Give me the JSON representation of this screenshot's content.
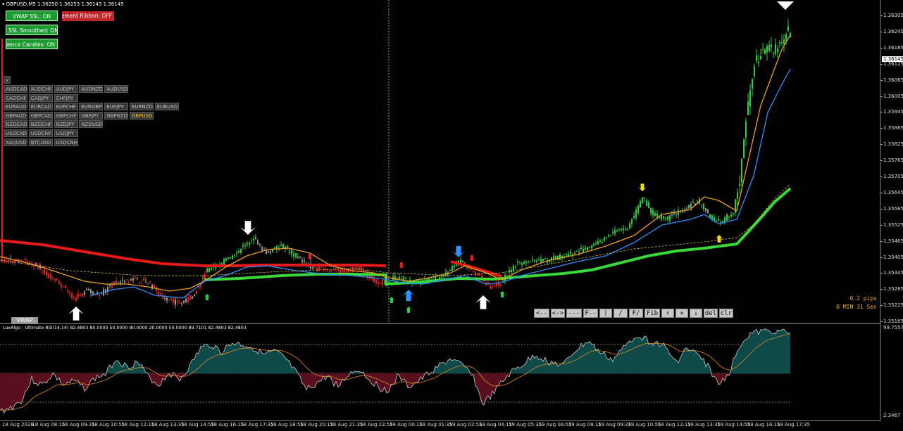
{
  "header": {
    "symbol_info": "GBPUSD,M5  1.36250 1.36253 1.36143 1.36145"
  },
  "buttons": {
    "vwap_ssl": "VWAP SSL: ON",
    "agreement_ribbon": "Agreement Ribbon: OFF",
    "ssl_smoothed": "SSL Smoothed: ON",
    "confluence_candles": "Confluence Candles: ON"
  },
  "symbols": {
    "toggle": "v",
    "rows": [
      [
        "AUDCAD",
        "AUDCHF",
        "AUDJPY",
        "AUDNZD",
        "AUDUSD"
      ],
      [
        "CADCHF",
        "CADJPY",
        "CHFJPY"
      ],
      [
        "EURAUD",
        "EURCAD",
        "EURCHF",
        "EURGBP",
        "EURJPY",
        "EURNZD",
        "EURUSD"
      ],
      [
        "GBPAUD",
        "GBPCAD",
        "GBPCHF",
        "GBPJPY",
        "GBPNZD",
        "GBPUSD"
      ],
      [
        "NZDCAD",
        "NZDCHF",
        "NZDJPY",
        "NZDUSD"
      ],
      [
        "USDCAD",
        "USDCHF",
        "USDJPY"
      ],
      [
        "XAUUSD",
        "BTCUSD",
        "USDCNH"
      ]
    ],
    "active": "GBPUSD"
  },
  "price_axis": {
    "labels": [
      "1.36305",
      "1.36245",
      "1.36185",
      "1.36125",
      "1.36065",
      "1.36005",
      "1.35945",
      "1.35885",
      "1.35825",
      "1.35765",
      "1.35705",
      "1.35645",
      "1.35585",
      "1.35525",
      "1.35465",
      "1.35405",
      "1.35345",
      "1.35285",
      "1.35225",
      "1.35165"
    ],
    "current_price": "1.36145"
  },
  "info": {
    "spread": "0.2 pips",
    "timer": "0 MIN 31 Sec"
  },
  "vwap_tab": "VWAP",
  "draw_tools": [
    "<--",
    "<->",
    "---",
    "F--",
    "|",
    "/",
    "F/",
    "Fib",
    "↑",
    "×",
    "↓",
    "del",
    "clr"
  ],
  "rsi": {
    "title": "LuxAlgo - Ultimate RSI(14,14) 82.4803 80.0000 50.0000 80.0000 20.0000 50.0000 89.7101 82.4803 82.4803",
    "max_label": "99.7557",
    "min_label": "2.3467"
  },
  "time_axis": [
    "18 Aug 2026",
    "18 Aug 08:15",
    "18 Aug 09:35",
    "18 Aug 10:55",
    "18 Aug 12:15",
    "18 Aug 13:35",
    "18 Aug 14:55",
    "18 Aug 16:15",
    "18 Aug 17:35",
    "18 Aug 18:55",
    "18 Aug 20:15",
    "18 Aug 21:35",
    "18 Aug 22:55",
    "19 Aug 00:15",
    "19 Aug 01:35",
    "19 Aug 02:55",
    "19 Aug 04:15",
    "19 Aug 05:35",
    "19 Aug 06:55",
    "19 Aug 08:15",
    "19 Aug 09:35",
    "19 Aug 10:55",
    "19 Aug 12:15",
    "19 Aug 13:35",
    "19 Aug 14:55",
    "19 Aug 16:15",
    "19 Aug 17:35"
  ],
  "colors": {
    "bull": "#2ecc40",
    "bear": "#e0201c",
    "neutral": "#9a9a9a",
    "ssl_bull": "#3ad83a",
    "ssl_bear": "#e61a1a",
    "ma_orange": "#f0a020",
    "ma_blue": "#2f8fff",
    "rsi_pos": "#0f4a4a",
    "rsi_neg": "#5a0f1e"
  }
}
